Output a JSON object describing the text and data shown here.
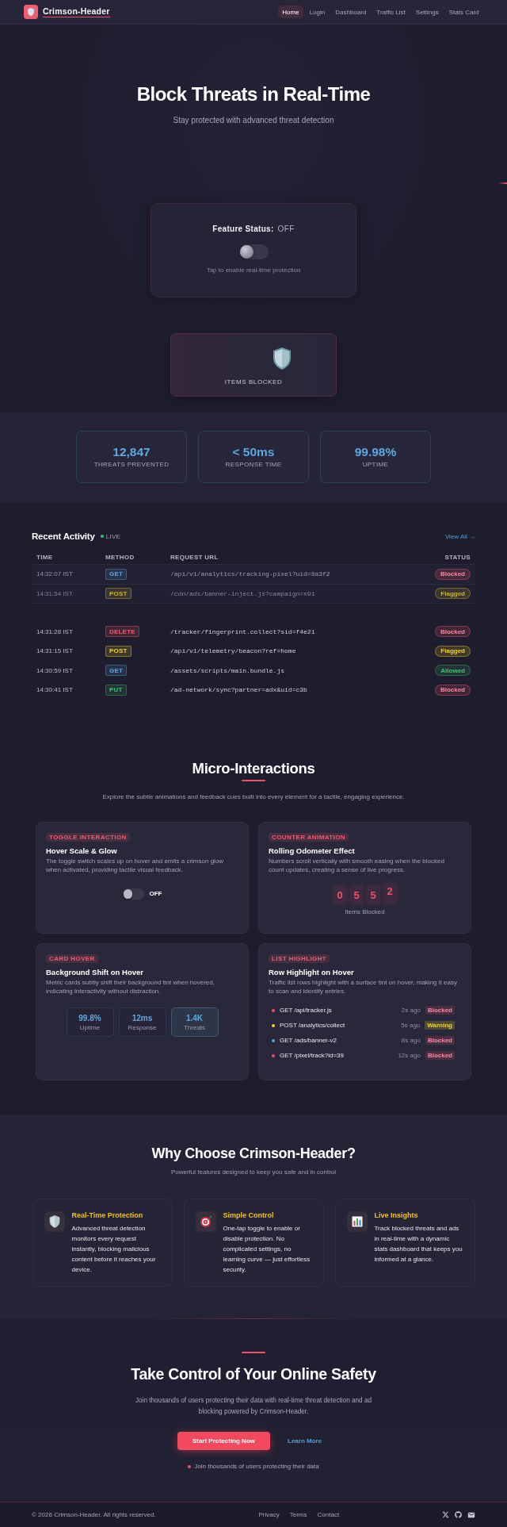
{
  "header": {
    "brand": "Crimson-Header",
    "nav": [
      {
        "label": "Home",
        "selected": true
      },
      {
        "label": "Login",
        "selected": false
      },
      {
        "label": "Dashboard",
        "selected": false
      },
      {
        "label": "Traffic List",
        "selected": false
      },
      {
        "label": "Settings",
        "selected": false
      },
      {
        "label": "Stats Card",
        "selected": false
      }
    ]
  },
  "hero": {
    "title": "Block Threats in Real-Time",
    "subtitle": "Stay protected with advanced threat detection"
  },
  "feature_status": {
    "label": "Feature Status:",
    "value": "OFF",
    "on": false,
    "hint": "Tap to enable real-time protection"
  },
  "items_blocked": {
    "label": "ITEMS BLOCKED"
  },
  "stats": [
    {
      "value": "12,847",
      "label": "THREATS PREVENTED"
    },
    {
      "value": "< 50ms",
      "label": "RESPONSE TIME"
    },
    {
      "value": "99.98%",
      "label": "UPTIME"
    }
  ],
  "activity": {
    "title": "Recent Activity",
    "live": "LIVE",
    "view_all": "View All →",
    "columns": [
      "TIME",
      "METHOD",
      "REQUEST URL",
      "STATUS"
    ],
    "rows": [
      {
        "time": "14:32:07 IST",
        "method": {
          "label": "GET",
          "kind": "get"
        },
        "url": "/api/v1/analytics/tracking-pixel?uid=8a3f2",
        "status": {
          "label": "Blocked",
          "kind": "blocked"
        },
        "highlighted": true,
        "dimmed": false
      },
      {
        "time": "14:31:54 IST",
        "method": {
          "label": "POST",
          "kind": "post"
        },
        "url": "/cdn/ads/banner-inject.js?campaign=x91",
        "status": {
          "label": "Flagged",
          "kind": "flagged"
        },
        "highlighted": true,
        "dimmed": true
      },
      {
        "time": "14:31:28 IST",
        "method": {
          "label": "DELETE",
          "kind": "delete"
        },
        "url": "/tracker/fingerprint.collect?sid=f4e21",
        "status": {
          "label": "Blocked",
          "kind": "blocked"
        },
        "highlighted": false,
        "dimmed": false
      },
      {
        "time": "14:31:15 IST",
        "method": {
          "label": "POST",
          "kind": "post"
        },
        "url": "/api/v1/telemetry/beacon?ref=home",
        "status": {
          "label": "Flagged",
          "kind": "flagged"
        },
        "highlighted": false,
        "dimmed": false
      },
      {
        "time": "14:30:59 IST",
        "method": {
          "label": "GET",
          "kind": "get"
        },
        "url": "/assets/scripts/main.bundle.js",
        "status": {
          "label": "Allowed",
          "kind": "allowed"
        },
        "highlighted": false,
        "dimmed": false
      },
      {
        "time": "14:30:41 IST",
        "method": {
          "label": "PUT",
          "kind": "put"
        },
        "url": "/ad-network/sync?partner=adx&uid=c3b",
        "status": {
          "label": "Blocked",
          "kind": "blocked"
        },
        "highlighted": false,
        "dimmed": false
      }
    ]
  },
  "micro": {
    "title": "Micro-Interactions",
    "subtitle": "Explore the subtle animations and feedback cues built into every element for a tactile, engaging experience.",
    "cards": [
      {
        "kind": "toggle",
        "tag": "TOGGLE INTERACTION",
        "title": "Hover Scale & Glow",
        "description": "The toggle switch scales up on hover and emits a crimson glow when activated, providing tactile visual feedback.",
        "toggle": {
          "on": false,
          "label": "OFF"
        }
      },
      {
        "kind": "counter",
        "tag": "COUNTER ANIMATION",
        "title": "Rolling Odometer Effect",
        "description": "Numbers scroll vertically with smooth easing when the blocked count updates, creating a sense of live progress.",
        "digits": [
          {
            "digit": "0",
            "rolling": false
          },
          {
            "digit": "5",
            "rolling": false
          },
          {
            "digit": "5",
            "rolling": false
          },
          {
            "digit": "2",
            "rolling": true
          }
        ],
        "caption": "Items Blocked"
      },
      {
        "kind": "metrics",
        "tag": "CARD HOVER",
        "title": "Background Shift on Hover",
        "description": "Metric cards subtly shift their background tint when hovered, indicating interactivity without distraction.",
        "metrics": [
          {
            "value": "99.8%",
            "label": "Uptime",
            "highlighted": false
          },
          {
            "value": "12ms",
            "label": "Response",
            "highlighted": false
          },
          {
            "value": "1.4K",
            "label": "Threats",
            "highlighted": true
          }
        ]
      },
      {
        "kind": "list",
        "tag": "LIST HIGHLIGHT",
        "title": "Row Highlight on Hover",
        "description": "Traffic list rows highlight with a surface tint on hover, making it easy to scan and identify entries.",
        "items": [
          {
            "label": "GET /api/tracker.js",
            "time": "2s ago",
            "color": "#f0506a",
            "badge": {
              "label": "Blocked",
              "kind": "blocked"
            }
          },
          {
            "label": "POST /analytics/collect",
            "time": "5s ago",
            "color": "#f2d024",
            "badge": {
              "label": "Warning",
              "kind": "warning"
            }
          },
          {
            "label": "GET /ads/banner-v2",
            "time": "8s ago",
            "color": "#4f9fd8",
            "badge": {
              "label": "Blocked",
              "kind": "blocked"
            }
          },
          {
            "label": "GET /pixel/track?id=39",
            "time": "12s ago",
            "color": "#f0506a",
            "badge": {
              "label": "Blocked",
              "kind": "blocked"
            }
          }
        ]
      }
    ]
  },
  "why": {
    "title": "Why Choose Crimson-Header?",
    "subtitle": "Powerful features designed to keep you safe and in control",
    "features": [
      {
        "title": "Real-Time Protection",
        "description": "Advanced threat detection monitors every request instantly, blocking malicious content before it reaches your device."
      },
      {
        "title": "Simple Control",
        "description": "One-tap toggle to enable or disable protection. No complicated settings, no learning curve — just effortless security."
      },
      {
        "title": "Live Insights",
        "description": "Track blocked threats and ads in real-time with a dynamic stats dashboard that keeps you informed at a glance."
      }
    ]
  },
  "cta": {
    "title": "Take Control of Your Online Safety",
    "description": "Join thousands of users protecting their data with real-time threat detection and ad blocking powered by Crimson-Header.",
    "primary_button": "Start Protecting Now",
    "secondary_button": "Learn More",
    "note": "Join thousands of users protecting their data"
  },
  "footer": {
    "copyright": "© 2026 Crimson-Header. All rights reserved.",
    "links": [
      "Privacy",
      "Terms",
      "Contact"
    ]
  }
}
